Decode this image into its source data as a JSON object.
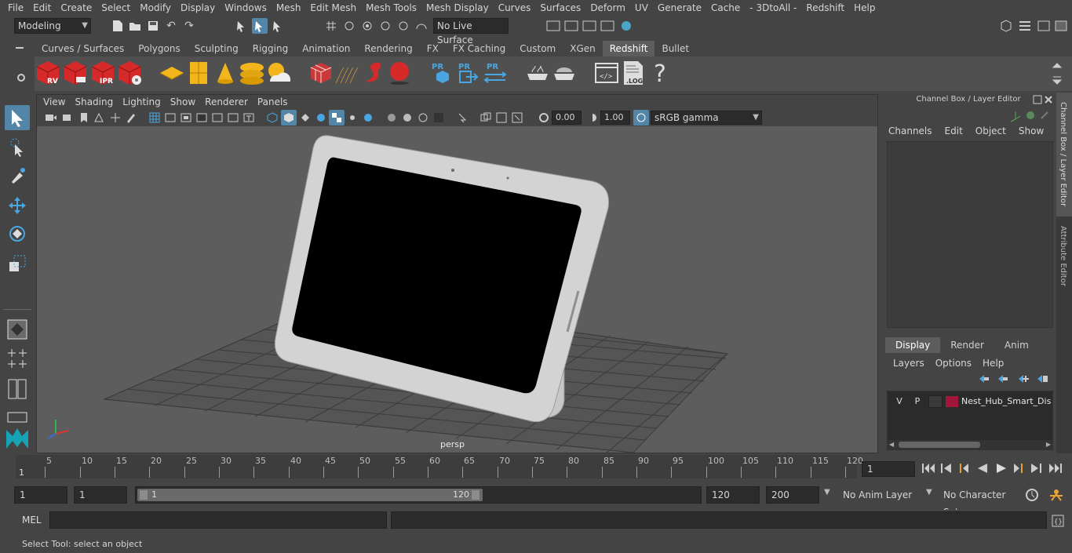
{
  "menubar": [
    "File",
    "Edit",
    "Create",
    "Select",
    "Modify",
    "Display",
    "Windows",
    "Mesh",
    "Edit Mesh",
    "Mesh Tools",
    "Mesh Display",
    "Curves",
    "Surfaces",
    "Deform",
    "UV",
    "Generate",
    "Cache",
    "- 3DtoAll -",
    "Redshift",
    "Help"
  ],
  "status": {
    "mode": "Modeling",
    "live_surface": "No Live Surface"
  },
  "shelf_tabs": [
    "Curves / Surfaces",
    "Polygons",
    "Sculpting",
    "Rigging",
    "Animation",
    "Rendering",
    "FX",
    "FX Caching",
    "Custom",
    "XGen",
    "Redshift",
    "Bullet"
  ],
  "shelf_active": "Redshift",
  "shelf_labels": {
    "rv": "RV",
    "ipr": "IPR",
    "pr": "PR",
    "log": ".LOG",
    "help": "?"
  },
  "viewport": {
    "menu": [
      "View",
      "Shading",
      "Lighting",
      "Show",
      "Renderer",
      "Panels"
    ],
    "exposure": "0.00",
    "gamma": "1.00",
    "colorspace": "sRGB gamma",
    "camera": "persp"
  },
  "channelbox": {
    "title": "Channel Box / Layer Editor",
    "menu": [
      "Channels",
      "Edit",
      "Object",
      "Show"
    ],
    "layer_tabs": [
      "Display",
      "Render",
      "Anim"
    ],
    "layer_active": "Display",
    "layer_menu": [
      "Layers",
      "Options",
      "Help"
    ],
    "layer": {
      "v": "V",
      "p": "P",
      "name": "Nest_Hub_Smart_Displ",
      "color": "#a0173a"
    },
    "side_tabs": [
      "Channel Box / Layer Editor",
      "Attribute Editor"
    ]
  },
  "timeline": {
    "ticks": [
      5,
      10,
      15,
      20,
      25,
      30,
      35,
      40,
      45,
      50,
      55,
      60,
      65,
      70,
      75,
      80,
      85,
      90,
      95,
      100,
      105,
      110,
      115,
      120
    ],
    "start_label": "1",
    "current_frame": "1"
  },
  "range": {
    "start": "1",
    "playback_start": "1",
    "slider_start": "1",
    "slider_end": "120",
    "playback_end": "120",
    "end": "200",
    "anim_layer": "No Anim Layer",
    "char_set": "No Character Set"
  },
  "cmdline": {
    "lang": "MEL"
  },
  "helpline": "Select Tool: select an object",
  "colors": {
    "accent": "#5285a6",
    "redshift_red": "#d62a2a",
    "shelf_bg": "#505050"
  }
}
